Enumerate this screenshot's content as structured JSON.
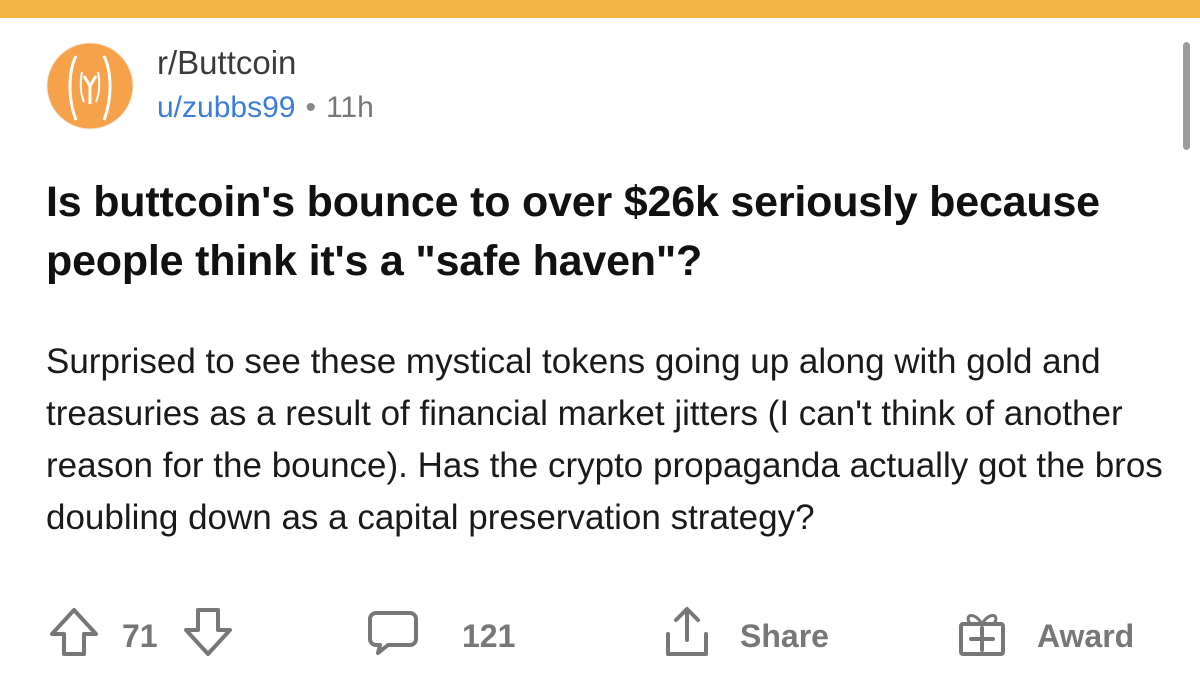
{
  "subreddit": "r/Buttcoin",
  "author": "u/zubbs99",
  "separator": "•",
  "age": "11h",
  "title": "Is buttcoin's bounce to over $26k seriously because people think it's a \"safe haven\"?",
  "body": "Surprised to see these mystical tokens going up along with gold and treasuries as a result of financial market jitters (I can't think of another reason for the bounce). Has the crypto propaganda actually got the bros doubling down as a capital preservation strategy?",
  "actions": {
    "upvote_count": "71",
    "comment_count": "121",
    "share_label": "Share",
    "award_label": "Award"
  },
  "colors": {
    "top_bar": "#f5b342",
    "avatar_bg": "#f5a24a",
    "username": "#3b7dd8",
    "action_gray": "#777777"
  },
  "icons": [
    "subreddit-avatar-icon",
    "upvote-icon",
    "downvote-icon",
    "comment-icon",
    "share-icon",
    "award-icon"
  ]
}
